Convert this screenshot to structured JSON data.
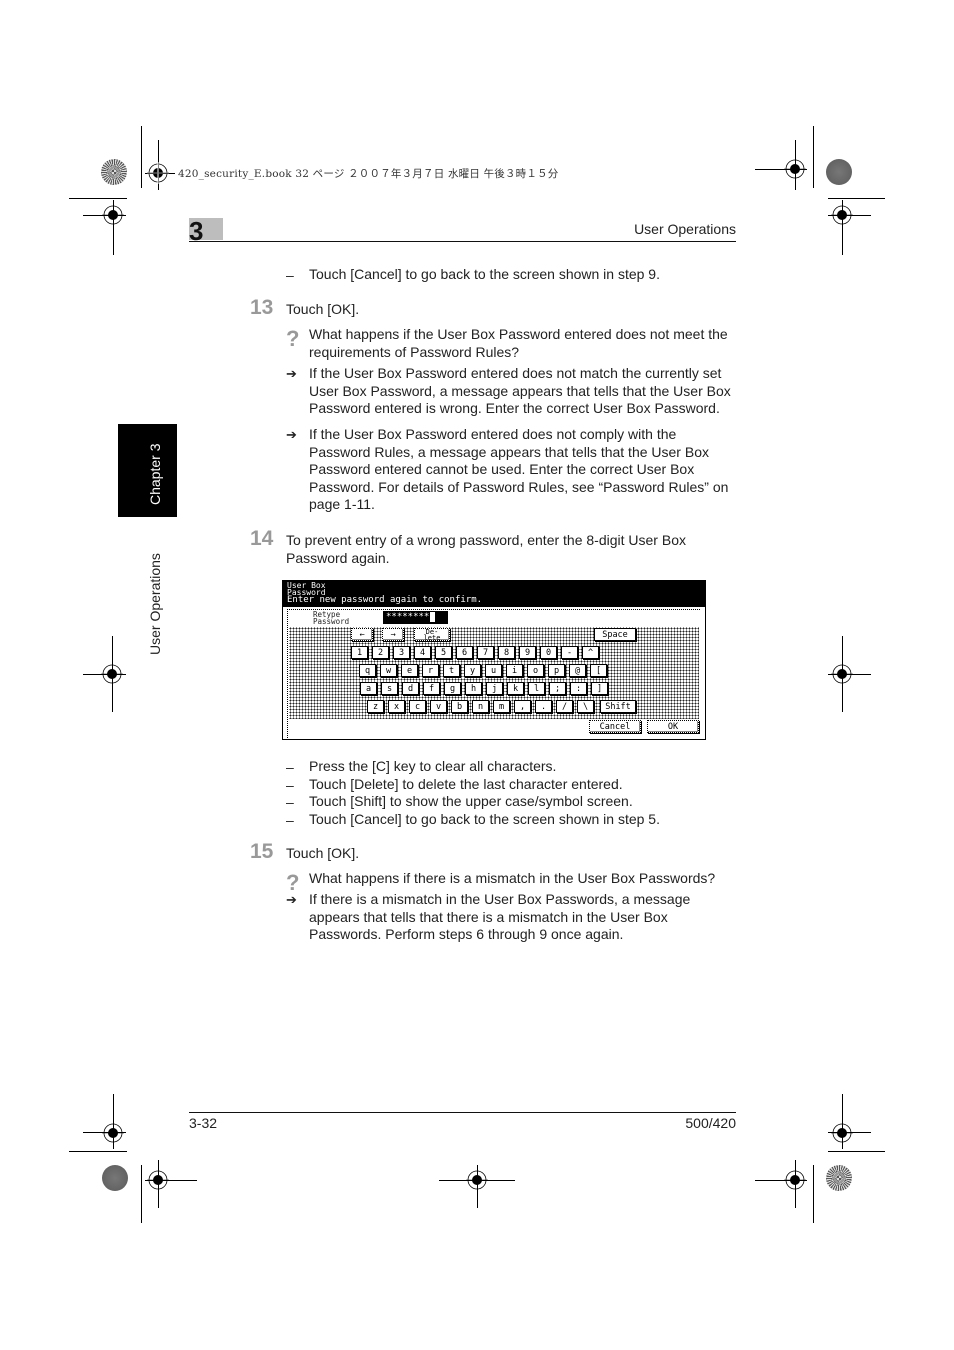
{
  "print_meta": "420_security_E.book  32 ページ  ２００７年３月７日  水曜日  午後３時１５分",
  "header": {
    "chapter_number": "3",
    "section_title": "User Operations"
  },
  "side_tab": {
    "chapter_label": "Chapter 3",
    "section_label": "User Operations"
  },
  "content": {
    "intro_dash": {
      "bullet": "–",
      "text": "Touch [Cancel] to go back to the screen shown in step 9."
    },
    "step13": {
      "number": "13",
      "text": "Touch [OK].",
      "question": "What happens if the User Box Password entered does not meet the requirements of Password Rules?",
      "answers": [
        "If the User Box Password entered does not match the currently set User Box Password, a message appears that tells that the User Box Password entered is wrong. Enter the correct User Box Password.",
        "If the User Box Password entered does not comply with the Password Rules, a message appears that tells that the User Box Password entered cannot be used. Enter the correct User Box Password. For details of Password Rules, see “Password Rules” on page 1-11."
      ]
    },
    "step14": {
      "number": "14",
      "text": "To prevent entry of a wrong password, enter the 8-digit User Box Password again.",
      "notes": [
        "Press the [C] key to clear all characters.",
        "Touch [Delete] to delete the last character entered.",
        "Touch [Shift] to show the upper case/symbol screen.",
        "Touch [Cancel] to go back to the screen shown in step 5."
      ]
    },
    "step15": {
      "number": "15",
      "text": "Touch [OK].",
      "question": "What happens if there is a mismatch in the User Box Passwords?",
      "answer": "If there is a mismatch in the User Box Passwords, a message appears that tells that there is a mismatch in the User Box Passwords. Perform steps 6 through 9 once again."
    },
    "icons": {
      "question": "?",
      "arrow": "➔",
      "dash": "–"
    }
  },
  "screen": {
    "title": "User Box\nPassword",
    "message": "Enter new password again to confirm.",
    "field_label": "Retype\nPassword",
    "field_value": "********",
    "left_arrow": "←",
    "right_arrow": "→",
    "delete_label": "De-\nlete",
    "space_label": "Space",
    "shift_label": "Shift",
    "cancel_label": "Cancel",
    "ok_label": "OK",
    "rows": [
      [
        "1",
        "2",
        "3",
        "4",
        "5",
        "6",
        "7",
        "8",
        "9",
        "0",
        "-",
        "^"
      ],
      [
        "q",
        "w",
        "e",
        "r",
        "t",
        "y",
        "u",
        "i",
        "o",
        "p",
        "@",
        "["
      ],
      [
        "a",
        "s",
        "d",
        "f",
        "g",
        "h",
        "j",
        "k",
        "l",
        ";",
        ":",
        "]"
      ],
      [
        "z",
        "x",
        "c",
        "v",
        "b",
        "n",
        "m",
        ",",
        ".",
        "/",
        "\\"
      ]
    ]
  },
  "footer": {
    "page_number": "3-32",
    "model": "500/420"
  }
}
